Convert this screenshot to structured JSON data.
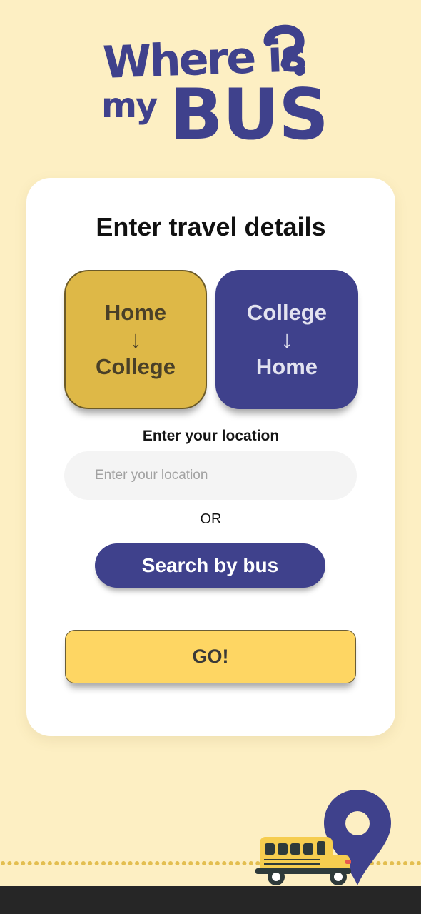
{
  "logo": {
    "line1": "Where is",
    "line2": "my",
    "line3": "BUS",
    "mark": "question-mark-icon"
  },
  "card": {
    "title": "Enter travel details"
  },
  "directions": [
    {
      "from": "Home",
      "arrow": "↓",
      "to": "College",
      "selected": true
    },
    {
      "from": "College",
      "arrow": "↓",
      "to": "Home",
      "selected": false
    }
  ],
  "location": {
    "label": "Enter your location",
    "placeholder": "Enter your location",
    "value": ""
  },
  "or_text": "OR",
  "search_bus_label": "Search by bus",
  "go_label": "GO!",
  "colors": {
    "background": "#FDEFC3",
    "primary": "#3F418C",
    "accent_gold": "#DEB847",
    "go_yellow": "#FED663",
    "bottom_bar": "#262626"
  },
  "illustration": {
    "icons": [
      "map-pin-icon",
      "school-bus-icon",
      "road-dots"
    ]
  }
}
